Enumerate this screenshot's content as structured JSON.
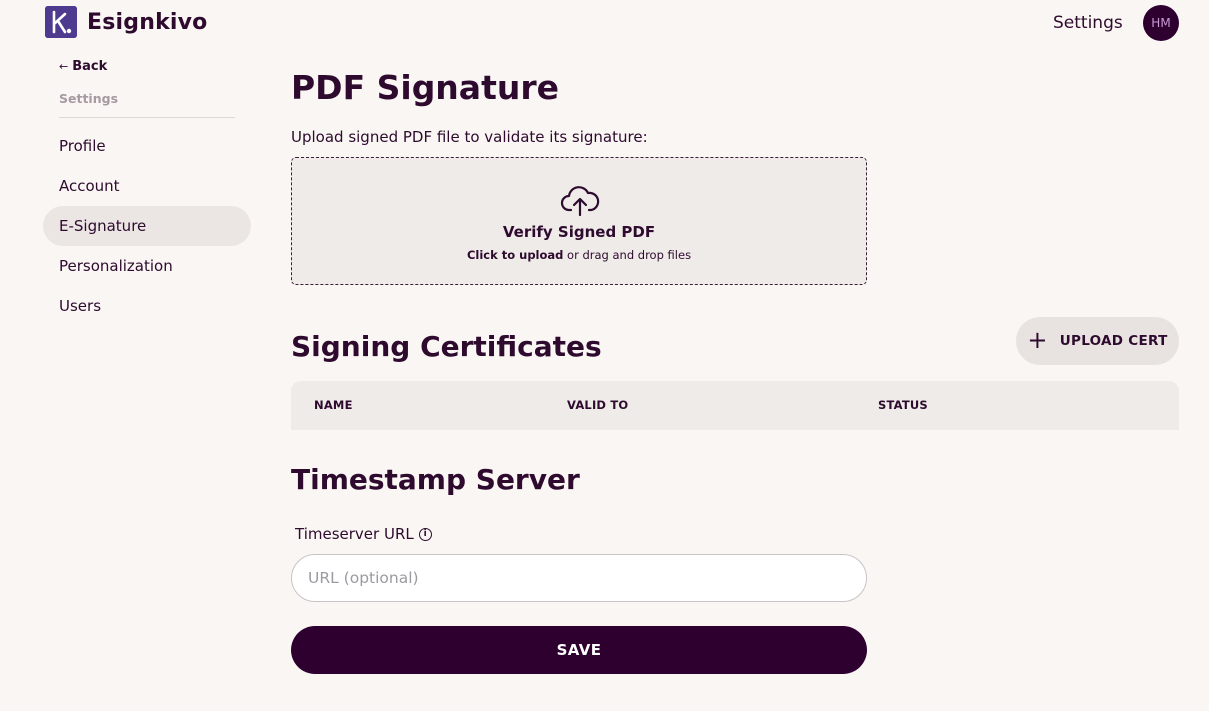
{
  "app": {
    "name": "Esignkivo"
  },
  "header": {
    "settings_label": "Settings",
    "avatar_initials": "HM"
  },
  "sidebar": {
    "back_label": "Back",
    "back_arrow": "←",
    "section_label": "Settings",
    "items": [
      {
        "label": "Profile",
        "active": false
      },
      {
        "label": "Account",
        "active": false
      },
      {
        "label": "E-Signature",
        "active": true
      },
      {
        "label": "Personalization",
        "active": false
      },
      {
        "label": "Users",
        "active": false
      }
    ]
  },
  "pdf_signature": {
    "title": "PDF Signature",
    "instruction": "Upload signed PDF file to validate its signature:",
    "dropzone": {
      "icon": "cloud-upload-icon",
      "title": "Verify Signed PDF",
      "hint_strong": "Click to upload",
      "hint_rest": " or drag and drop files"
    }
  },
  "certificates": {
    "title": "Signing Certificates",
    "upload_button": "UPLOAD CERT",
    "columns": [
      "NAME",
      "VALID TO",
      "STATUS"
    ]
  },
  "timestamp": {
    "title": "Timestamp Server",
    "field_label": "Timeserver URL",
    "info_glyph": "i",
    "placeholder": "URL (optional)",
    "value": "",
    "save_label": "SAVE"
  },
  "colors": {
    "background": "#faf6f3",
    "primary": "#2d0030",
    "brand": "#4e3a8e",
    "panel": "#efebe8",
    "active_nav": "#ebe5e3"
  }
}
